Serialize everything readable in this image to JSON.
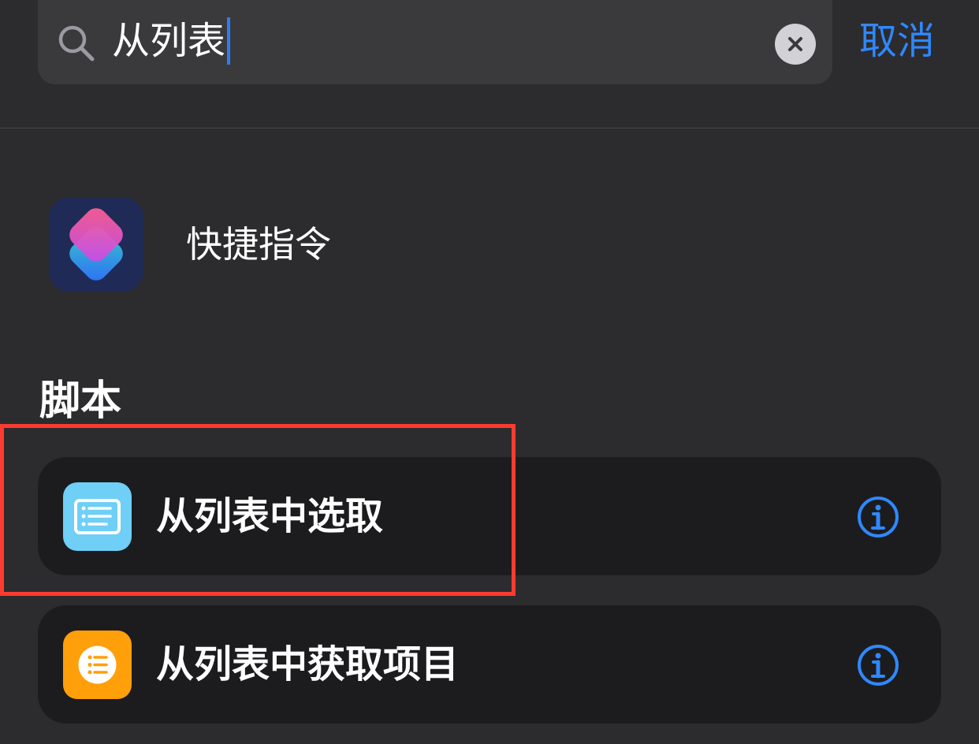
{
  "search": {
    "query": "从列表",
    "cancel_label": "取消"
  },
  "app_result": {
    "label": "快捷指令",
    "icon": "shortcuts-app-icon"
  },
  "section": {
    "title": "脚本"
  },
  "actions": [
    {
      "label": "从列表中选取",
      "icon": "list-choose-icon",
      "color": "#6fcff6",
      "highlighted": true
    },
    {
      "label": "从列表中获取项目",
      "icon": "list-items-icon",
      "color": "#ff9f0a",
      "highlighted": false
    }
  ],
  "colors": {
    "background": "#2c2c2e",
    "search_bar": "#3a3a3c",
    "card": "#1c1c1e",
    "accent": "#2f88ff",
    "highlight": "#ff3b30"
  }
}
